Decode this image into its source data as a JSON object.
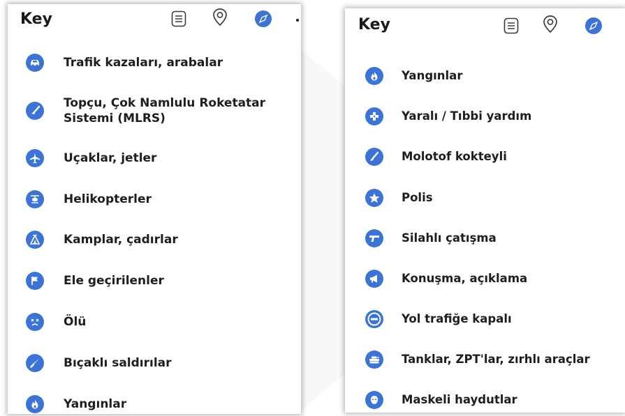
{
  "colors": {
    "accent": "#3b74d6",
    "text": "#1e1e1e",
    "panel_bg": "#ffffff"
  },
  "left_panel": {
    "title": "Key",
    "header_icons": [
      "list-icon",
      "map-pin-icon",
      "compass-icon"
    ],
    "items": [
      {
        "icon": "car-icon",
        "label": "Trafik kazaları, arabalar"
      },
      {
        "icon": "artillery-icon",
        "label": "Topçu, Çok Namlulu Roketatar Sistemi (MLRS)"
      },
      {
        "icon": "airplane-icon",
        "label": "Uçaklar, jetler"
      },
      {
        "icon": "helicopter-icon",
        "label": "Helikopterler"
      },
      {
        "icon": "tent-icon",
        "label": "Kamplar, çadırlar"
      },
      {
        "icon": "flag-icon",
        "label": "Ele geçirilenler"
      },
      {
        "icon": "dead-face-icon",
        "label": "Ölü"
      },
      {
        "icon": "knife-icon",
        "label": "Bıçaklı saldırılar"
      },
      {
        "icon": "fire-icon",
        "label": "Yangınlar"
      }
    ]
  },
  "right_panel": {
    "title": "Key",
    "header_icons": [
      "list-icon",
      "map-pin-icon",
      "compass-icon"
    ],
    "items": [
      {
        "icon": "fire-icon",
        "label": "Yangınlar"
      },
      {
        "icon": "medical-cross-icon",
        "label": "Yaralı / Tıbbi yardım"
      },
      {
        "icon": "molotov-icon",
        "label": "Molotof kokteyli"
      },
      {
        "icon": "star-icon",
        "label": "Polis"
      },
      {
        "icon": "gun-icon",
        "label": "Silahlı çatışma"
      },
      {
        "icon": "megaphone-icon",
        "label": "Konuşma, açıklama"
      },
      {
        "icon": "no-entry-icon",
        "label": "Yol trafiğe kapalı"
      },
      {
        "icon": "tank-icon",
        "label": "Tanklar, ZPT'lar, zırhlı araçlar"
      },
      {
        "icon": "mask-icon",
        "label": "Maskeli haydutlar"
      }
    ]
  }
}
